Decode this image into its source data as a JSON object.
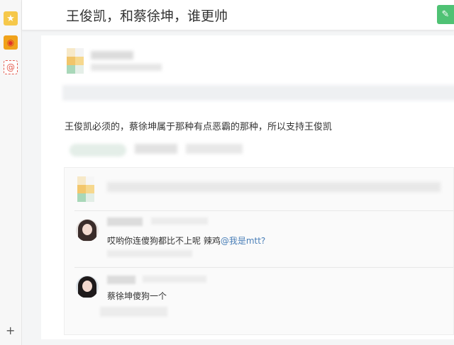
{
  "header": {
    "title": "王俊凯，和蔡徐坤，谁更帅",
    "write_icon": "✎"
  },
  "sidebar": {
    "items": [
      {
        "icon": "star-icon",
        "glyph": "★"
      },
      {
        "icon": "weibo-icon",
        "glyph": "◉"
      },
      {
        "icon": "at-icon",
        "glyph": "@"
      }
    ],
    "add_glyph": "+"
  },
  "answer": {
    "text": "王俊凯必须的，蔡徐坤属于那种有点恶霸的那种，所以支持王俊凯"
  },
  "comments": [
    {
      "text": "哎哟你连傻狗都比不上呢  辣鸡",
      "mention": "@我是mtt?"
    },
    {
      "text": "蔡徐坤傻狗一个",
      "mention": ""
    }
  ],
  "colors": {
    "accent_green": "#4fc274",
    "mention_blue": "#4a7fb8"
  }
}
